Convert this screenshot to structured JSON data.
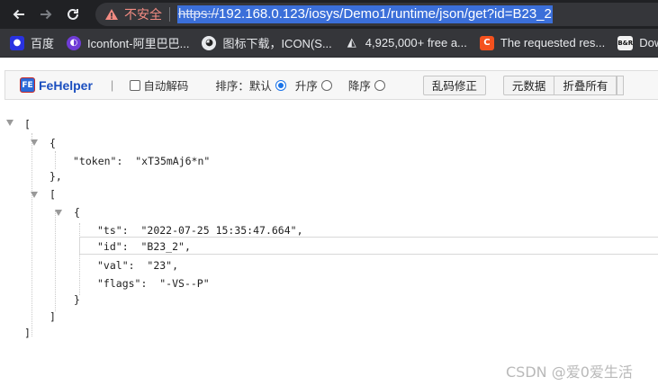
{
  "browser": {
    "back_icon": "arrow-left-icon",
    "forward_icon": "arrow-right-icon",
    "reload_icon": "reload-icon",
    "security_label": "不安全",
    "url_scheme": "https://",
    "url_rest": "192.168.0.123/iosys/Demo1/runtime/json/get?id=B23_2"
  },
  "bookmarks": [
    {
      "label": "百度",
      "icon": "baidu-paw-icon",
      "color": "#2932e1"
    },
    {
      "label": "Iconfont-阿里巴巴...",
      "icon": "iconfont-icon",
      "color": "#6f3cd6"
    },
    {
      "label": "图标下载，ICON(S...",
      "icon": "panda-icon",
      "color": "#e8eaed"
    },
    {
      "label": "4,925,000+ free a...",
      "icon": "flaticon-icon",
      "color": "#e8eaed"
    },
    {
      "label": "The requested res...",
      "icon": "c-icon",
      "color": "#f4511e"
    },
    {
      "label": "Dow",
      "icon": "br-icon",
      "color": "#111111"
    }
  ],
  "fehelper": {
    "title": "FeHelper",
    "badge": "FE",
    "auto_decode": "自动解码",
    "sort_label": "排序：",
    "sort_default": "默认",
    "sort_asc": "升序",
    "sort_desc": "降序",
    "fix_garbled": "乱码修正",
    "raw_data": "元数据",
    "collapse_all": "折叠所有"
  },
  "json_lines": {
    "l1": "[",
    "l2": "{",
    "l3_key": "\"token\":",
    "l3_val": "\"xT35mAj6*n\"",
    "l4": "},",
    "l5": "[",
    "l6": "{",
    "l7_key": "\"ts\":",
    "l7_val": "\"2022-07-25 15:35:47.664\",",
    "l8_key": "\"id\":",
    "l8_val": "\"B23_2\",",
    "l9_key": "\"val\":",
    "l9_val": "\"23\",",
    "l10_key": "\"flags\":",
    "l10_val": "\"-VS--P\"",
    "l11": "}",
    "l12": "]",
    "l13": "]"
  },
  "watermark": "CSDN @爱0爱生活"
}
